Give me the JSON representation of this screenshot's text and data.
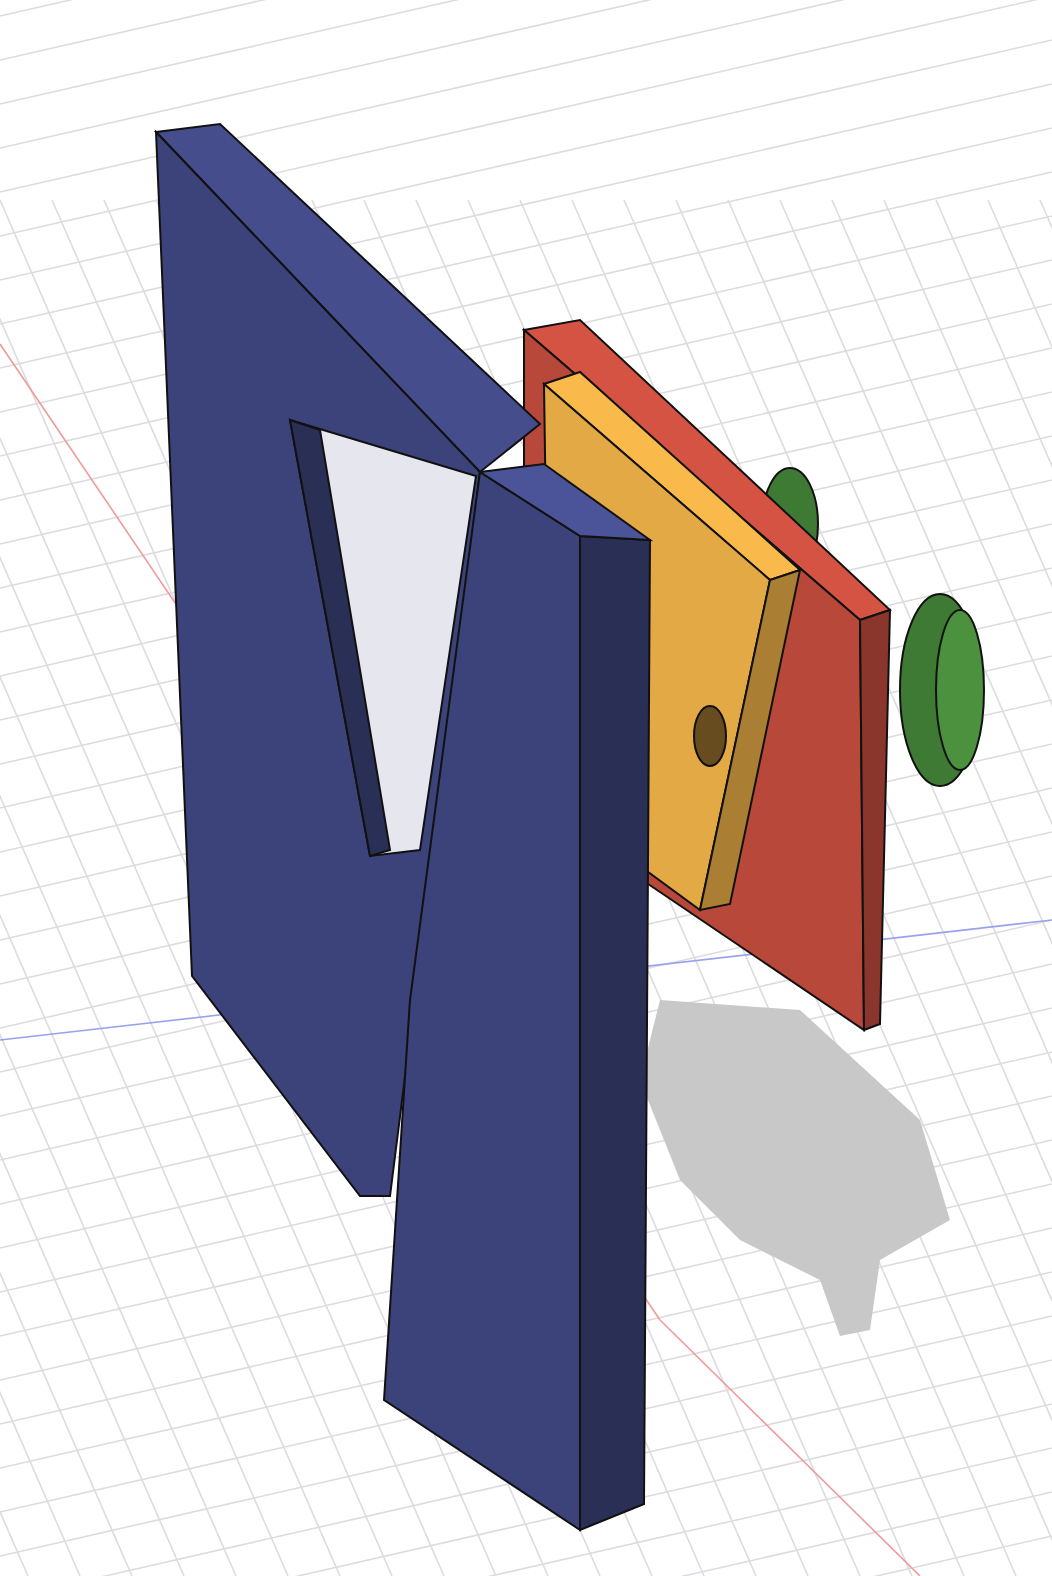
{
  "viewport": {
    "show_grid": true,
    "show_shadow": true,
    "bodies": [
      {
        "kind": "frame",
        "color": "#3c437a"
      },
      {
        "kind": "plate",
        "color": "#b8483a"
      },
      {
        "kind": "block",
        "color": "#e3a944"
      },
      {
        "kind": "cylinder",
        "color": "#3f7a34"
      }
    ]
  }
}
